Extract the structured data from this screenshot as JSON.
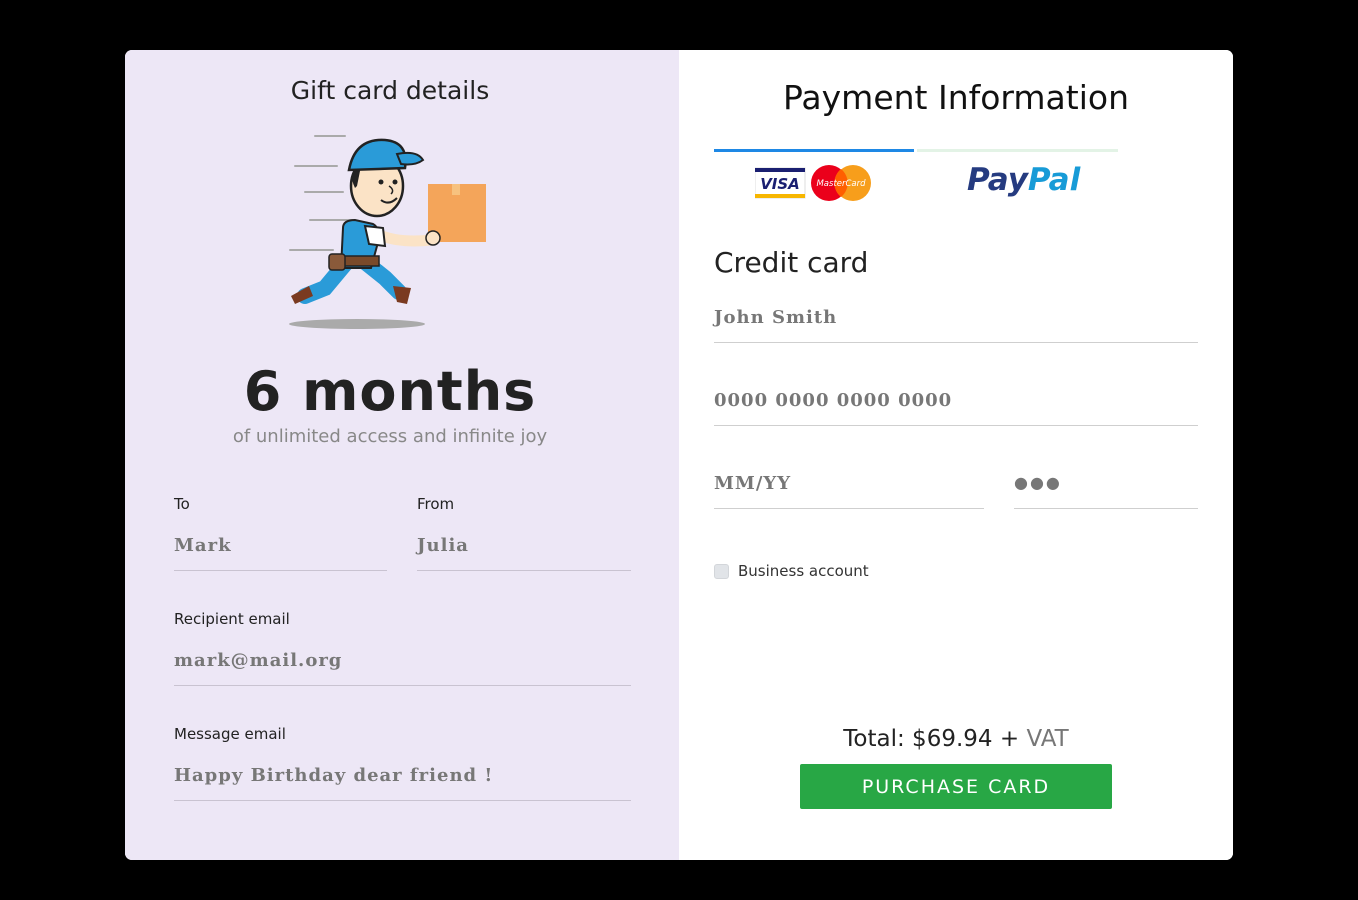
{
  "gift": {
    "title": "Gift card details",
    "duration": "6 months",
    "tagline": "of unlimited access and infinite joy",
    "to_label": "To",
    "to_value": "Mark",
    "from_label": "From",
    "from_value": "Julia",
    "recipient_label": "Recipient email",
    "recipient_value": "mark@mail.org",
    "message_label": "Message email",
    "message_value": "Happy Birthday dear friend !"
  },
  "payment": {
    "title": "Payment Information",
    "tabs": [
      {
        "label": "Card",
        "logos": [
          "visa-logo",
          "mastercard-logo"
        ],
        "active": true
      },
      {
        "label": "PayPal",
        "logos": [
          "paypal-logo"
        ],
        "active": false
      }
    ],
    "paypal_part1": "Pay",
    "paypal_part2": "Pal",
    "visa_text": "VISA",
    "mastercard_text": "MasterCard",
    "section_title": "Credit card",
    "name_value": "John Smith",
    "card_number_value": "0000 0000 0000 0000",
    "expiry_value": "MM/YY",
    "cvv_value": "●●●",
    "business_label": "Business account",
    "business_checked": false,
    "total_label": "Total: $69.94 +",
    "total_vat": "VAT",
    "purchase_label": "PURCHASE CARD"
  },
  "colors": {
    "left_bg": "#ede7f6",
    "active_tab": "#1e88e5",
    "inactive_tab": "#e3f3e6",
    "purchase_bg": "#28a745"
  }
}
